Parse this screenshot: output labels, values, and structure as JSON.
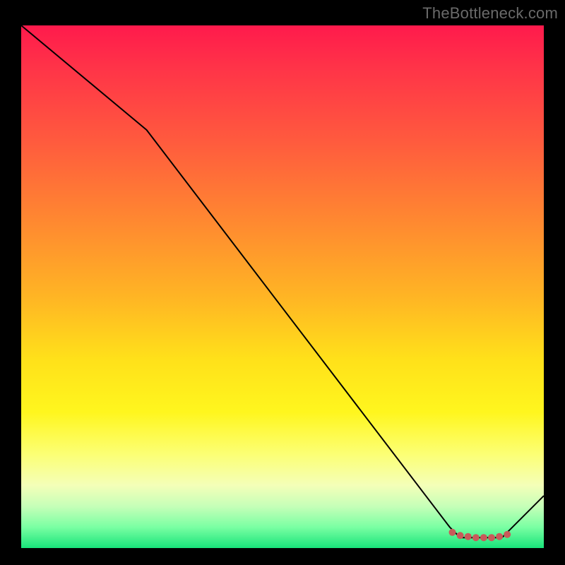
{
  "watermark": "TheBottleneck.com",
  "chart_data": {
    "type": "line",
    "title": "",
    "xlabel": "",
    "ylabel": "",
    "xlim": [
      0,
      100
    ],
    "ylim": [
      0,
      100
    ],
    "grid": false,
    "legend": false,
    "series": [
      {
        "name": "curve",
        "data": [
          {
            "x": 0,
            "y": 100
          },
          {
            "x": 24,
            "y": 80
          },
          {
            "x": 82,
            "y": 4
          },
          {
            "x": 84,
            "y": 2
          },
          {
            "x": 92,
            "y": 2
          },
          {
            "x": 100,
            "y": 10
          }
        ],
        "stroke": "#000000",
        "stroke_width": 2
      }
    ],
    "markers": [
      {
        "x": 82.5,
        "y": 3.0,
        "color": "#c95a5a",
        "r": 5
      },
      {
        "x": 84.0,
        "y": 2.4,
        "color": "#c95a5a",
        "r": 5
      },
      {
        "x": 85.5,
        "y": 2.2,
        "color": "#c95a5a",
        "r": 5
      },
      {
        "x": 87.0,
        "y": 2.0,
        "color": "#c95a5a",
        "r": 5
      },
      {
        "x": 88.5,
        "y": 2.0,
        "color": "#c95a5a",
        "r": 5
      },
      {
        "x": 90.0,
        "y": 2.0,
        "color": "#c95a5a",
        "r": 5
      },
      {
        "x": 91.5,
        "y": 2.2,
        "color": "#c95a5a",
        "r": 5
      },
      {
        "x": 93.0,
        "y": 2.6,
        "color": "#c95a5a",
        "r": 5
      }
    ]
  }
}
